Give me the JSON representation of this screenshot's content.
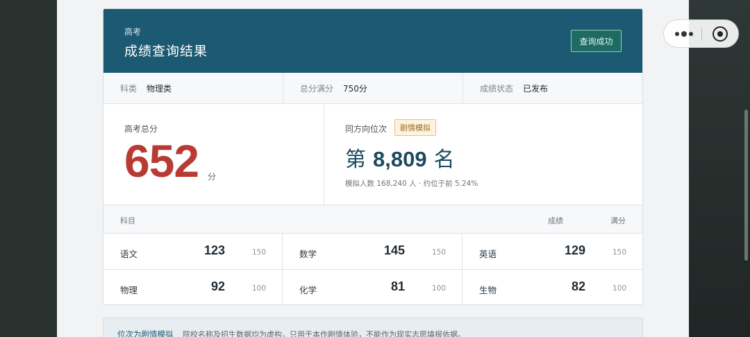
{
  "header": {
    "subtitle": "高考",
    "title": "成绩查询结果",
    "status_badge": "查询成功"
  },
  "meta": [
    {
      "label": "科类",
      "value": "物理类"
    },
    {
      "label": "总分满分",
      "value": "750分"
    },
    {
      "label": "成绩状态",
      "value": "已发布"
    }
  ],
  "total": {
    "label": "高考总分",
    "score": "652",
    "unit": "分"
  },
  "rank": {
    "label": "同方向位次",
    "tag": "剧情模拟",
    "prefix": "第",
    "number": "8,809",
    "suffix": "名",
    "note": "模拟人数 168,240 人 · 约位于前 5.24%"
  },
  "subjects_header": {
    "subject": "科目",
    "score": "成绩",
    "full": "满分"
  },
  "subjects": [
    {
      "name": "语文",
      "score": "123",
      "full": "150"
    },
    {
      "name": "数学",
      "score": "145",
      "full": "150"
    },
    {
      "name": "英语",
      "score": "129",
      "full": "150"
    },
    {
      "name": "物理",
      "score": "92",
      "full": "100"
    },
    {
      "name": "化学",
      "score": "81",
      "full": "100"
    },
    {
      "name": "生物",
      "score": "82",
      "full": "100"
    }
  ],
  "notice": {
    "title": "位次为剧情模拟",
    "text": "院校名称及招生数据均为虚构，只用于本作剧情体验，不能作为现实志愿填报依据。"
  },
  "colors": {
    "header": "#1c5a73",
    "score": "#b83a32",
    "tag": "#9a6a1d"
  },
  "capsule": {
    "more_icon": "more-dots-icon",
    "close_icon": "close-circle-icon"
  }
}
